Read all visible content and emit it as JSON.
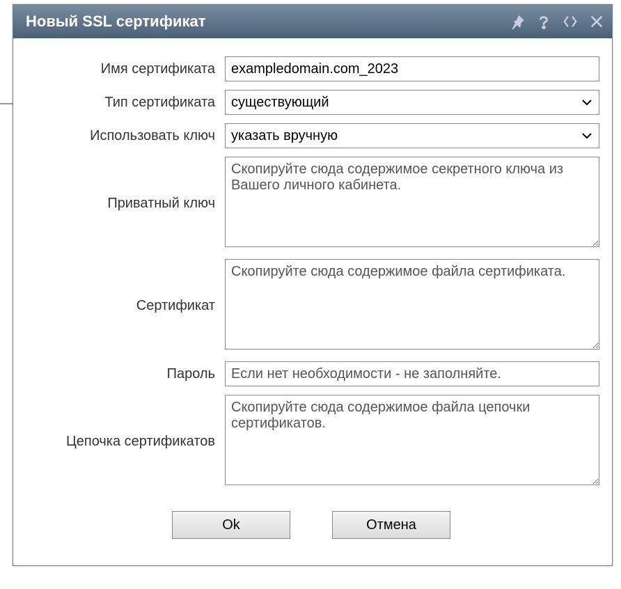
{
  "titlebar": {
    "title": "Новый SSL сертификат"
  },
  "form": {
    "cert_name": {
      "label": "Имя сертификата",
      "value": "exampledomain.com_2023"
    },
    "cert_type": {
      "label": "Тип сертификата",
      "selected": "существующий"
    },
    "use_key": {
      "label": "Использовать ключ",
      "selected": "указать вручную"
    },
    "private_key": {
      "label": "Приватный ключ",
      "placeholder": "Скопируйте сюда содержимое секретного ключа из Вашего личного кабинета."
    },
    "certificate": {
      "label": "Сертификат",
      "placeholder": "Скопируйте сюда содержимое файла сертификата."
    },
    "password": {
      "label": "Пароль",
      "placeholder": "Если нет необходимости - не заполняйте."
    },
    "chain": {
      "label": "Цепочка сертификатов",
      "placeholder": "Скопируйте сюда содержимое файла цепочки сертификатов."
    }
  },
  "buttons": {
    "ok": "Ok",
    "cancel": "Отмена"
  }
}
